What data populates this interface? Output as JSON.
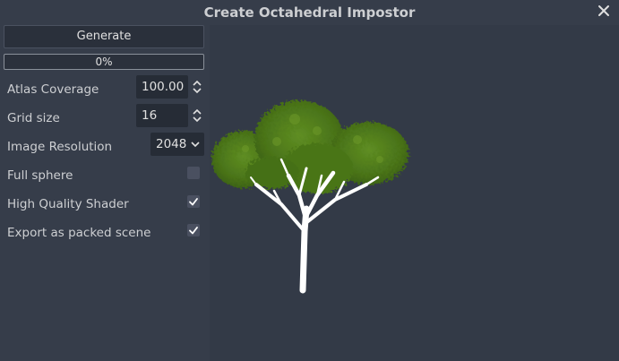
{
  "window": {
    "title": "Create Octahedral Impostor"
  },
  "icons": {
    "close": "close-icon",
    "spin_arrows": "spin-arrows-icon",
    "dropdown": "chevron-down-icon",
    "check": "check-icon"
  },
  "colors": {
    "background": "#363d4a",
    "viewport": "#333a47",
    "field": "#262c36",
    "checkbox": "#4a5060",
    "foliage": "#4e7a1c",
    "trunk": "#ffffff"
  },
  "actions": {
    "generate_label": "Generate"
  },
  "progress": {
    "text": "0%",
    "value": 0
  },
  "settings": {
    "atlas_coverage": {
      "label": "Atlas Coverage",
      "value": "100.00"
    },
    "grid_size": {
      "label": "Grid size",
      "value": "16"
    },
    "image_resolution": {
      "label": "Image Resolution",
      "value": "2048"
    },
    "full_sphere": {
      "label": "Full sphere",
      "checked": false
    },
    "high_quality_shader": {
      "label": "High Quality Shader",
      "checked": true
    },
    "export_packed_scene": {
      "label": "Export as packed scene",
      "checked": true
    }
  }
}
